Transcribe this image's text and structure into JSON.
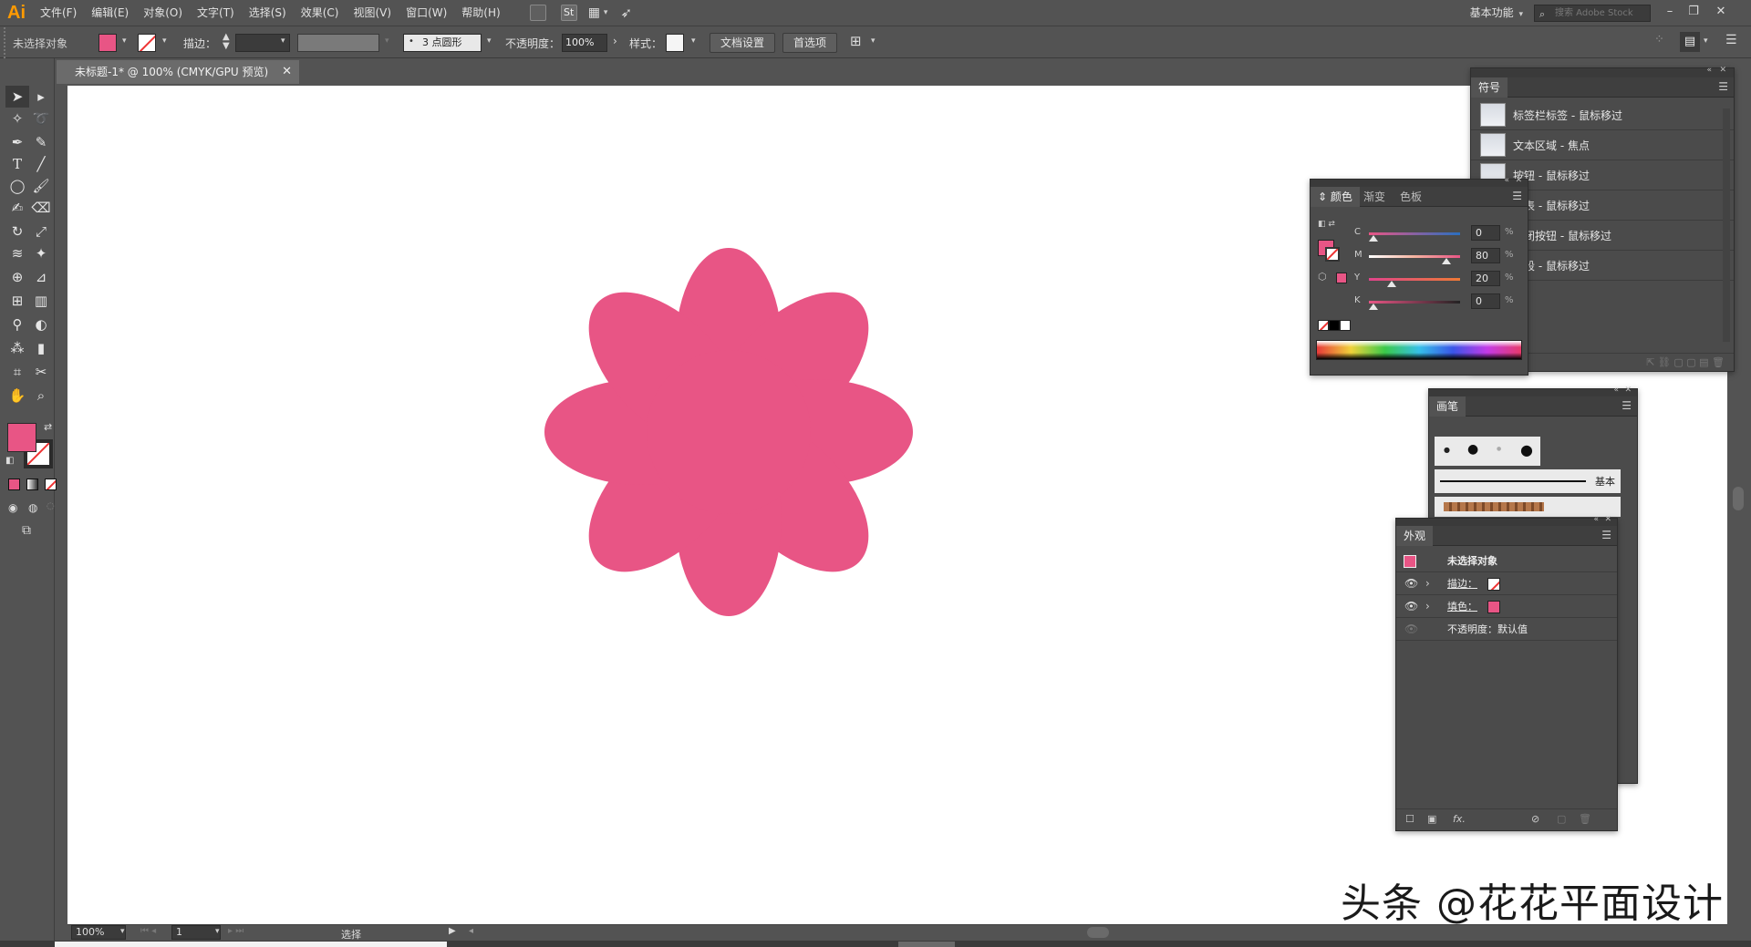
{
  "app": {
    "logo": "Ai"
  },
  "menubar": {
    "items": [
      "文件(F)",
      "编辑(E)",
      "对象(O)",
      "文字(T)",
      "选择(S)",
      "效果(C)",
      "视图(V)",
      "窗口(W)",
      "帮助(H)"
    ],
    "st_label": "St",
    "workspace": "基本功能",
    "search_placeholder": "搜索 Adobe Stock"
  },
  "controlbar": {
    "selection": "未选择对象",
    "stroke_label": "描边：",
    "brush": "3 点圆形",
    "opacity_label": "不透明度：",
    "opacity_value": "100%",
    "style_label": "样式：",
    "doc_setup": "文档设置",
    "prefs": "首选项",
    "fill_color": "#e85585"
  },
  "document": {
    "tab_title": "未标题-1* @ 100% (CMYK/GPU 预览)",
    "zoom": "100%",
    "artboard": "1",
    "status": "选择",
    "shape_color": "#e85585"
  },
  "symbols_panel": {
    "title": "符号",
    "items": [
      "标签栏标签 - 鼠标移过",
      "文本区域 - 焦点",
      "按钮 - 鼠标移过",
      "列表 - 鼠标移过",
      "关闭按钮 - 鼠标移过",
      "字段 - 鼠标移过"
    ]
  },
  "color_panel": {
    "tabs": [
      "颜色",
      "渐变",
      "色板"
    ],
    "channels": [
      {
        "label": "C",
        "value": "0"
      },
      {
        "label": "M",
        "value": "80"
      },
      {
        "label": "Y",
        "value": "20"
      },
      {
        "label": "K",
        "value": "0"
      }
    ],
    "percent": "%"
  },
  "brush_panel": {
    "title": "画笔",
    "basic_label": "基本"
  },
  "appearance_panel": {
    "title": "外观",
    "header": "未选择对象",
    "stroke": "描边：",
    "fill": "填色：",
    "opacity": "不透明度：默认值",
    "fx": "fx."
  },
  "watermark": "头条 @花花平面设计"
}
